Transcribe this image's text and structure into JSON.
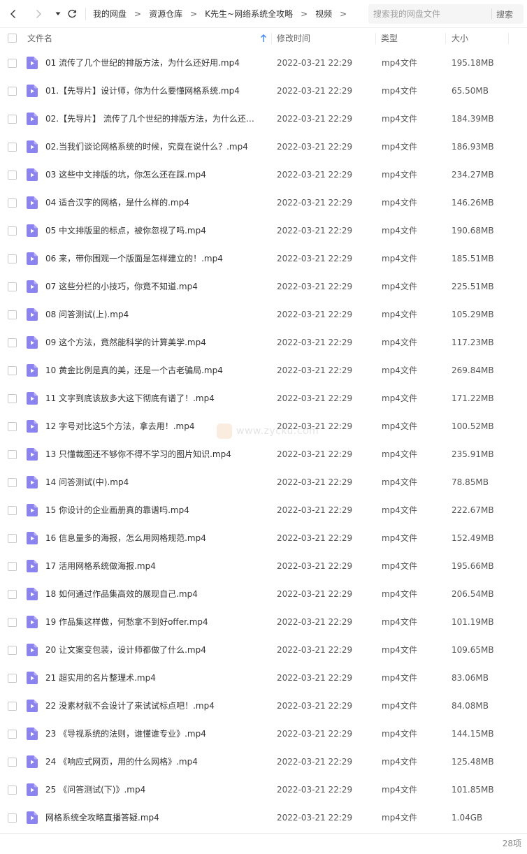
{
  "nav": {
    "breadcrumbs": [
      "我的网盘",
      "资源仓库",
      "K先生~网络系统全攻略",
      "视频"
    ],
    "separator": ">"
  },
  "search": {
    "placeholder": "搜索我的网盘文件",
    "button_label": "搜索"
  },
  "table": {
    "headers": {
      "name": "文件名",
      "time": "修改时间",
      "type": "类型",
      "size": "大小"
    },
    "sort": "name-ascending",
    "rows": [
      {
        "name": "01 流传了几个世纪的排版方法，为什么还好用.mp4",
        "time": "2022-03-21 22:29",
        "type": "mp4文件",
        "size": "195.18MB"
      },
      {
        "name": "01.【先导片】设计师，你为什么要懂网格系统.mp4",
        "time": "2022-03-21 22:29",
        "type": "mp4文件",
        "size": "65.50MB"
      },
      {
        "name": "02.【先导片】 流传了几个世纪的排版方法，为什么还好...",
        "time": "2022-03-21 22:29",
        "type": "mp4文件",
        "size": "184.39MB"
      },
      {
        "name": "02.当我们谈论网格系统的时候，究竟在说什么？.mp4",
        "time": "2022-03-21 22:29",
        "type": "mp4文件",
        "size": "186.93MB"
      },
      {
        "name": "03 这些中文排版的坑，你怎么还在踩.mp4",
        "time": "2022-03-21 22:29",
        "type": "mp4文件",
        "size": "234.27MB"
      },
      {
        "name": "04 适合汉字的网格，是什么样的.mp4",
        "time": "2022-03-21 22:29",
        "type": "mp4文件",
        "size": "146.26MB"
      },
      {
        "name": "05 中文排版里的标点，被你忽视了吗.mp4",
        "time": "2022-03-21 22:29",
        "type": "mp4文件",
        "size": "190.68MB"
      },
      {
        "name": "06 来，带你围观一个版面是怎样建立的！.mp4",
        "time": "2022-03-21 22:29",
        "type": "mp4文件",
        "size": "185.51MB"
      },
      {
        "name": "07 这些分栏的小技巧，你竟不知道.mp4",
        "time": "2022-03-21 22:29",
        "type": "mp4文件",
        "size": "225.51MB"
      },
      {
        "name": "08 问答测试(上).mp4",
        "time": "2022-03-21 22:29",
        "type": "mp4文件",
        "size": "105.29MB"
      },
      {
        "name": "09 这个方法，竟然能科学的计算美学.mp4",
        "time": "2022-03-21 22:29",
        "type": "mp4文件",
        "size": "117.23MB"
      },
      {
        "name": "10 黄金比例是真的美，还是一个古老骗局.mp4",
        "time": "2022-03-21 22:29",
        "type": "mp4文件",
        "size": "269.84MB"
      },
      {
        "name": "11 文字到底该放多大这下彻底有谱了！.mp4",
        "time": "2022-03-21 22:29",
        "type": "mp4文件",
        "size": "171.22MB"
      },
      {
        "name": "12 字号对比这5个方法，拿去用！.mp4",
        "time": "2022-03-21 22:29",
        "type": "mp4文件",
        "size": "100.52MB"
      },
      {
        "name": "13 只懂裁图还不够你不得不学习的图片知识.mp4",
        "time": "2022-03-21 22:29",
        "type": "mp4文件",
        "size": "235.91MB"
      },
      {
        "name": "14 问答测试(中).mp4",
        "time": "2022-03-21 22:29",
        "type": "mp4文件",
        "size": "78.85MB"
      },
      {
        "name": "15 你设计的企业画册真的靠谱吗.mp4",
        "time": "2022-03-21 22:29",
        "type": "mp4文件",
        "size": "222.67MB"
      },
      {
        "name": "16 信息量多的海报，怎么用网格规范.mp4",
        "time": "2022-03-21 22:29",
        "type": "mp4文件",
        "size": "152.49MB"
      },
      {
        "name": "17 活用网格系统做海报.mp4",
        "time": "2022-03-21 22:29",
        "type": "mp4文件",
        "size": "195.66MB"
      },
      {
        "name": "18 如何通过作品集高效的展现自己.mp4",
        "time": "2022-03-21 22:29",
        "type": "mp4文件",
        "size": "206.54MB"
      },
      {
        "name": "19 作品集这样做，何愁拿不到好offer.mp4",
        "time": "2022-03-21 22:29",
        "type": "mp4文件",
        "size": "101.19MB"
      },
      {
        "name": "20 让文案变包装，设计师都做了什么.mp4",
        "time": "2022-03-21 22:29",
        "type": "mp4文件",
        "size": "109.65MB"
      },
      {
        "name": "21 超实用的名片整理术.mp4",
        "time": "2022-03-21 22:29",
        "type": "mp4文件",
        "size": "83.06MB"
      },
      {
        "name": "22 没素材就不会设计了来试试标点吧！.mp4",
        "time": "2022-03-21 22:29",
        "type": "mp4文件",
        "size": "84.08MB"
      },
      {
        "name": "23 《导视系统的法则，谁懂谁专业》.mp4",
        "time": "2022-03-21 22:29",
        "type": "mp4文件",
        "size": "144.15MB"
      },
      {
        "name": "24 《响应式网页，用的什么网格》.mp4",
        "time": "2022-03-21 22:29",
        "type": "mp4文件",
        "size": "125.48MB"
      },
      {
        "name": "25 《问答测试(下)》.mp4",
        "time": "2022-03-21 22:29",
        "type": "mp4文件",
        "size": "101.85MB"
      },
      {
        "name": "网格系统全攻略直播答疑.mp4",
        "time": "2022-03-21 22:29",
        "type": "mp4文件",
        "size": "1.04GB"
      }
    ]
  },
  "footer": {
    "item_count": "28项"
  },
  "watermark": {
    "text": "www.zycku.com"
  },
  "colors": {
    "video_icon": "#8b84f0",
    "header_text": "#666666",
    "accent": "#3b82f6"
  }
}
